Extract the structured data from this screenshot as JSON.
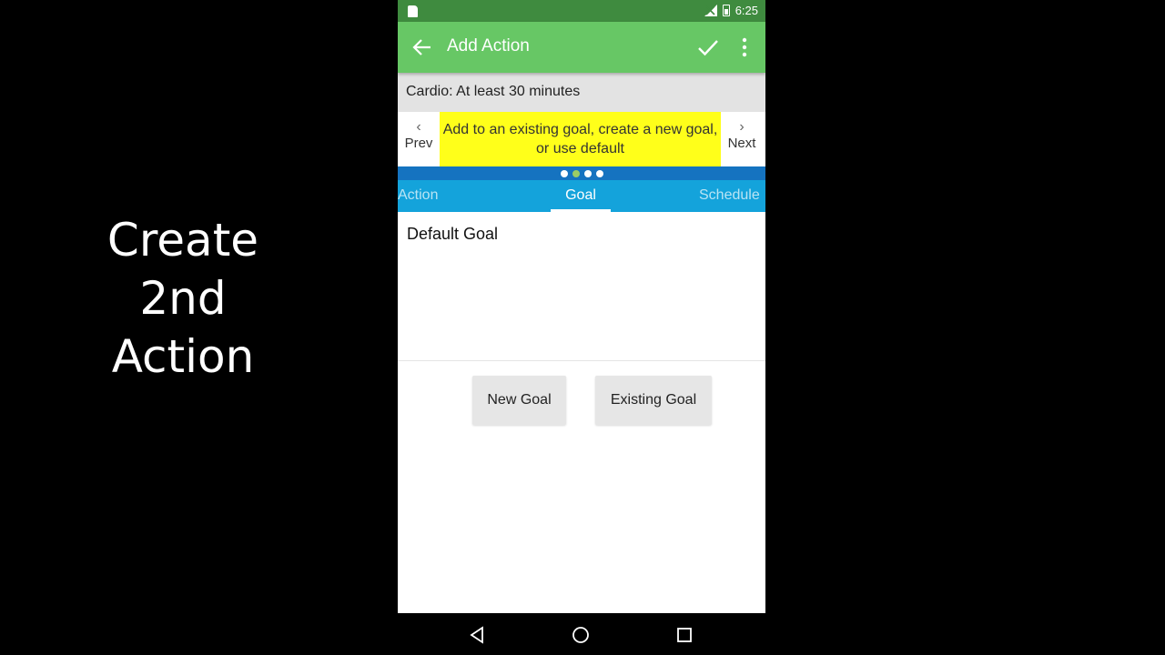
{
  "caption": {
    "line1": "Create",
    "line2": "2nd",
    "line3": "Action"
  },
  "status_bar": {
    "time": "6:25",
    "icons": [
      "sim-card-icon",
      "signal-off-icon",
      "battery-icon"
    ]
  },
  "app_bar": {
    "title": "Add Action",
    "back_icon": "arrow-left-icon",
    "confirm_icon": "check-icon",
    "menu_icon": "more-vertical-icon",
    "color": "#67c765"
  },
  "subheader": {
    "text": "Cardio: At least 30 minutes"
  },
  "tip": {
    "prev_label": "Prev",
    "next_label": "Next",
    "message": "Add to an existing goal, create a new goal, or use default",
    "highlight_color": "#ffff1a"
  },
  "pager": {
    "count": 4,
    "active_index": 1
  },
  "tabs": [
    {
      "label": "Action"
    },
    {
      "label": "Goal",
      "selected": true
    },
    {
      "label": "Schedule"
    }
  ],
  "content": {
    "goal_name": "Default Goal",
    "new_goal_label": "New Goal",
    "existing_goal_label": "Existing Goal"
  },
  "nav_bar": {
    "icons": [
      "nav-back-icon",
      "nav-home-icon",
      "nav-recents-icon"
    ]
  }
}
